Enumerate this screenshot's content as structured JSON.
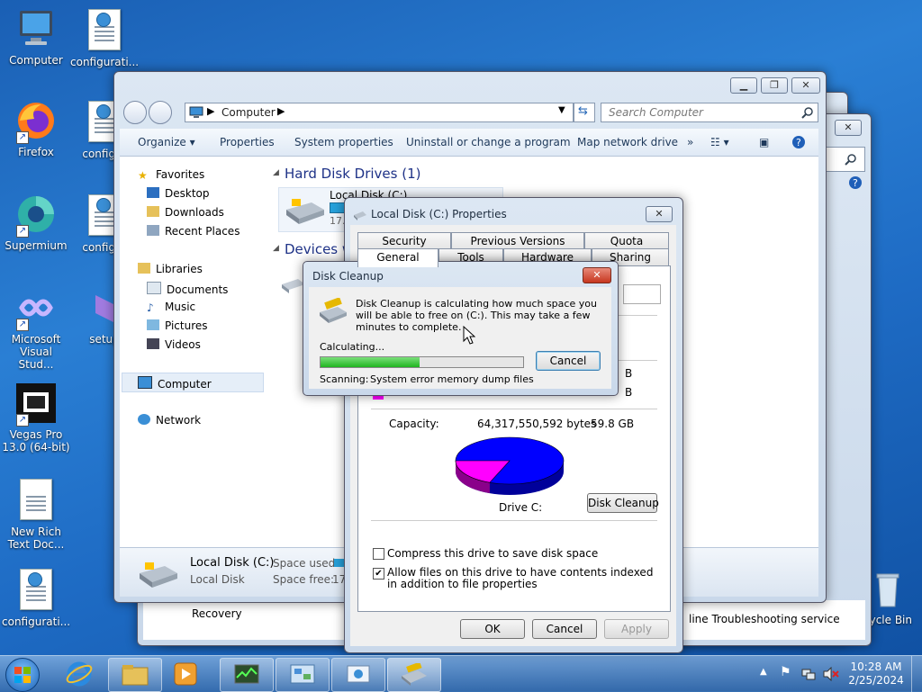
{
  "desktop": {
    "icons": [
      {
        "label": "Computer"
      },
      {
        "label": "configurati..."
      },
      {
        "label": "Firefox"
      },
      {
        "label": "configur"
      },
      {
        "label": "Supermium"
      },
      {
        "label": "configur"
      },
      {
        "label": "Microsoft Visual Stud..."
      },
      {
        "label": "setup"
      },
      {
        "label": "Vegas Pro 13.0 (64-bit)"
      },
      {
        "label": "New Rich Text Doc..."
      },
      {
        "label": "configurati..."
      },
      {
        "label": "cycle Bin"
      }
    ]
  },
  "explorer": {
    "address": "Computer",
    "search_placeholder": "Search Computer",
    "toolbar": {
      "organize": "Organize",
      "properties": "Properties",
      "system_properties": "System properties",
      "uninstall": "Uninstall or change a program",
      "map_network": "Map network drive",
      "more": "»"
    },
    "nav": {
      "favorites": "Favorites",
      "desktop": "Desktop",
      "downloads": "Downloads",
      "recent": "Recent Places",
      "libraries": "Libraries",
      "documents": "Documents",
      "music": "Music",
      "pictures": "Pictures",
      "videos": "Videos",
      "computer": "Computer",
      "network": "Network"
    },
    "sections": {
      "hard_disk": "Hard Disk Drives (1)",
      "devices": "Devices w"
    },
    "drive_tile": {
      "name": "Local Disk (C:)",
      "free": "17.9"
    },
    "details": {
      "name": "Local Disk (C:)",
      "type": "Local Disk",
      "space_used_label": "Space used:",
      "space_free_label": "Space free:",
      "space_free_value": "17.9"
    }
  },
  "background_windows": {
    "recovery": "Recovery",
    "troubleshoot": "line Troubleshooting service"
  },
  "properties": {
    "title": "Local Disk (C:) Properties",
    "tabs_row1": [
      "Security",
      "Previous Versions",
      "Quota"
    ],
    "tabs_row2": [
      "General",
      "Tools",
      "Hardware",
      "Sharing"
    ],
    "used_unit": "B",
    "free_unit": "B",
    "capacity_label": "Capacity:",
    "capacity_bytes": "64,317,550,592 bytes",
    "capacity_gb": "59.8 GB",
    "drive_label": "Drive C:",
    "disk_cleanup_btn": "Disk Cleanup",
    "compress_label": "Compress this drive to save disk space",
    "index_label": "Allow files on this drive to have contents indexed in addition to file properties",
    "compress_checked": false,
    "index_checked": true,
    "ok": "OK",
    "cancel": "Cancel",
    "apply": "Apply",
    "pie": {
      "used_fraction": 0.7,
      "used_color": "#0000ff",
      "free_color": "#ff00ff"
    }
  },
  "cleanup": {
    "title": "Disk Cleanup",
    "message": "Disk Cleanup is calculating how much space you will be able to free on  (C:). This may take a few minutes to complete.",
    "status": "Calculating...",
    "progress": 0.49,
    "cancel": "Cancel",
    "scanning_label": "Scanning:",
    "scanning_value": "System error memory dump files"
  },
  "taskbar": {
    "time": "10:28 AM",
    "date": "2/25/2024"
  }
}
